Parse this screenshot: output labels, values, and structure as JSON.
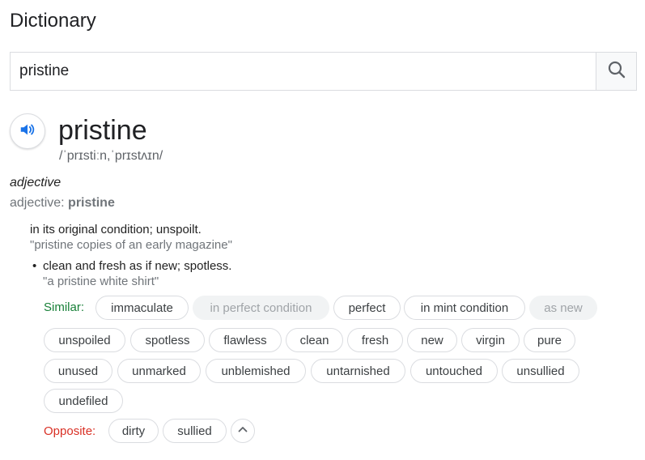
{
  "page": {
    "title": "Dictionary"
  },
  "search": {
    "value": "pristine"
  },
  "entry": {
    "word": "pristine",
    "phonetic": "/ˈprɪstiːn,ˈprɪstʌɪn/",
    "part_of_speech": "adjective",
    "pos_line_prefix": "adjective: ",
    "pos_line_word": "pristine",
    "senses": [
      {
        "definition": "in its original condition; unspoilt.",
        "example": "\"pristine copies of an early magazine\""
      },
      {
        "bullet": "•",
        "definition": "clean and fresh as if new; spotless.",
        "example": "\"a pristine white shirt\""
      }
    ]
  },
  "similar": {
    "label": "Similar:",
    "chips": [
      {
        "text": "immaculate",
        "muted": false
      },
      {
        "text": "in perfect condition",
        "muted": true
      },
      {
        "text": "perfect",
        "muted": false
      },
      {
        "text": "in mint condition",
        "muted": false
      },
      {
        "text": "as new",
        "muted": true
      },
      {
        "text": "unspoiled",
        "muted": false
      },
      {
        "text": "spotless",
        "muted": false
      },
      {
        "text": "flawless",
        "muted": false
      },
      {
        "text": "clean",
        "muted": false
      },
      {
        "text": "fresh",
        "muted": false
      },
      {
        "text": "new",
        "muted": false
      },
      {
        "text": "virgin",
        "muted": false
      },
      {
        "text": "pure",
        "muted": false
      },
      {
        "text": "unused",
        "muted": false
      },
      {
        "text": "unmarked",
        "muted": false
      },
      {
        "text": "unblemished",
        "muted": false
      },
      {
        "text": "untarnished",
        "muted": false
      },
      {
        "text": "untouched",
        "muted": false
      },
      {
        "text": "unsullied",
        "muted": false
      },
      {
        "text": "undefiled",
        "muted": false
      }
    ]
  },
  "opposite": {
    "label": "Opposite:",
    "chips": [
      {
        "text": "dirty"
      },
      {
        "text": "sullied"
      }
    ]
  },
  "icons": {
    "search": "search-icon",
    "speaker": "speaker-icon",
    "collapse": "chevron-up-icon"
  },
  "colors": {
    "similar_label": "#188038",
    "opposite_label": "#d93025",
    "speaker_accent": "#1a73e8"
  }
}
